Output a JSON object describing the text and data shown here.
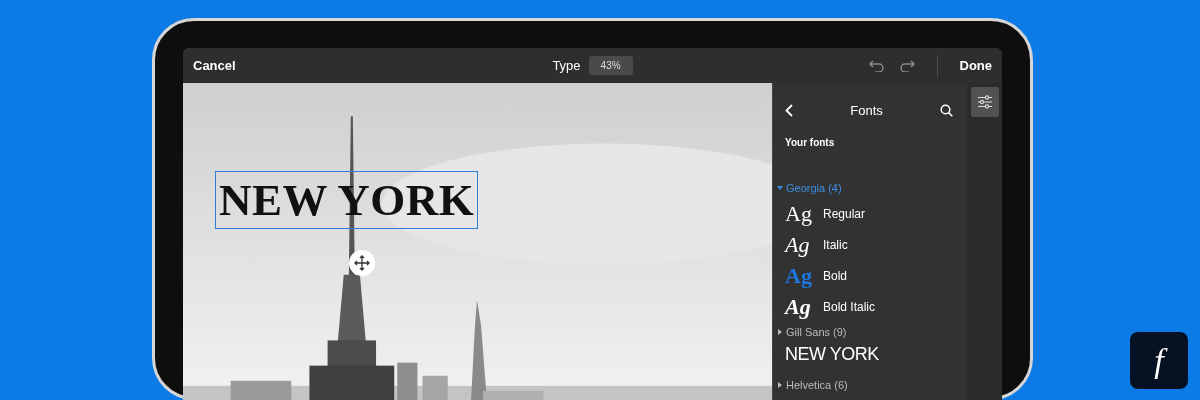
{
  "topbar": {
    "cancel": "Cancel",
    "mode_label": "Type",
    "zoom": "43%",
    "done": "Done"
  },
  "canvas": {
    "text_layer": "NEW YORK",
    "selected": true
  },
  "panel": {
    "title": "Fonts",
    "section": "Your fonts",
    "families": [
      {
        "name": "Georgia (4)",
        "expanded": true,
        "styles": [
          {
            "sample": "Ag",
            "label": "Regular",
            "kind": "regular",
            "selected": false
          },
          {
            "sample": "Ag",
            "label": "Italic",
            "kind": "italic",
            "selected": false
          },
          {
            "sample": "Ag",
            "label": "Bold",
            "kind": "bold",
            "selected": true
          },
          {
            "sample": "Ag",
            "label": "Bold Italic",
            "kind": "bold-italic",
            "selected": false
          }
        ]
      },
      {
        "name": "Gill Sans (9)",
        "expanded": false,
        "preview": "NEW YORK"
      },
      {
        "name": "Helvetica (6)",
        "expanded": false
      }
    ]
  },
  "logo": {
    "text": "f"
  }
}
